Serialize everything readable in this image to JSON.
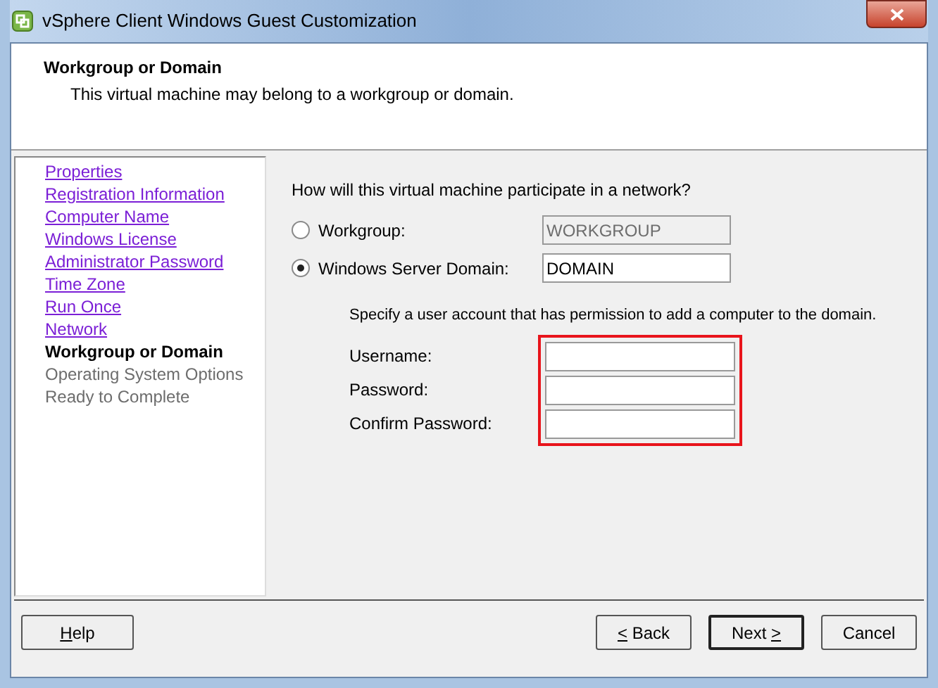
{
  "window": {
    "title": "vSphere Client Windows Guest Customization"
  },
  "header": {
    "title": "Workgroup or Domain",
    "subtitle": "This virtual machine may belong to a workgroup or domain."
  },
  "steps": [
    {
      "label": "Properties",
      "selected": false,
      "disabled": false
    },
    {
      "label": "Registration Information",
      "selected": false,
      "disabled": false
    },
    {
      "label": "Computer Name",
      "selected": false,
      "disabled": false
    },
    {
      "label": "Windows License",
      "selected": false,
      "disabled": false
    },
    {
      "label": "Administrator Password",
      "selected": false,
      "disabled": false
    },
    {
      "label": "Time Zone",
      "selected": false,
      "disabled": false
    },
    {
      "label": "Run Once",
      "selected": false,
      "disabled": false
    },
    {
      "label": "Network",
      "selected": false,
      "disabled": false
    },
    {
      "label": "Workgroup or Domain",
      "selected": true,
      "disabled": false
    },
    {
      "label": "Operating System Options",
      "selected": false,
      "disabled": true
    },
    {
      "label": "Ready to Complete",
      "selected": false,
      "disabled": true
    }
  ],
  "question": "How will this virtual machine participate in a network?",
  "options": [
    {
      "label": "Workgroup:",
      "selected": false,
      "value": "WORKGROUP",
      "disabled": true
    },
    {
      "label": "Windows Server Domain:",
      "selected": true,
      "value": "DOMAIN",
      "disabled": false
    }
  ],
  "credentials": {
    "note": "Specify a user account that has permission to add a computer to the domain.",
    "highlighted": true,
    "fields": [
      {
        "label": "Username:"
      },
      {
        "label": "Password:"
      },
      {
        "label": "Confirm Password:"
      }
    ]
  },
  "buttons": [
    {
      "key": "H",
      "after": "elp",
      "default": false
    },
    {
      "key": "<",
      "after": " Back",
      "default": false
    },
    {
      "before": "Next ",
      "key": ">",
      "default": true
    },
    {
      "after": "Cancel",
      "default": false
    }
  ]
}
